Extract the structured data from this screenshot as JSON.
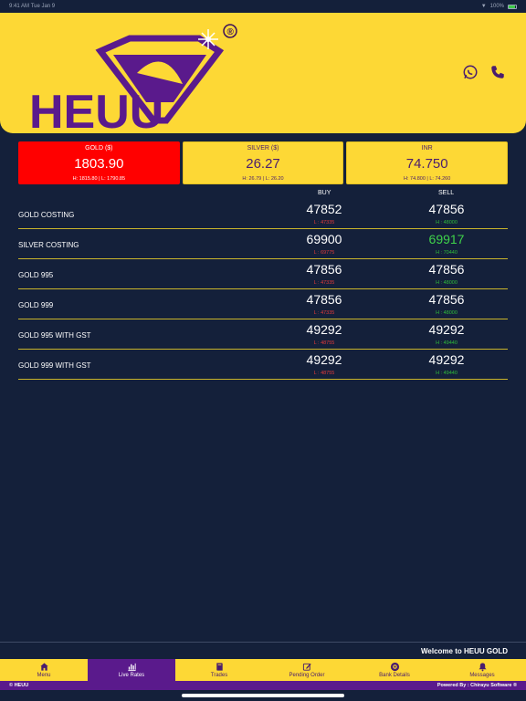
{
  "status_bar": {
    "time": "9:41 AM",
    "date": "Tue Jan 9",
    "battery": "100%"
  },
  "brand": {
    "name": "HEUU",
    "registered": "®"
  },
  "header_icons": [
    "whatsapp-icon",
    "phone-icon"
  ],
  "rate_cards": [
    {
      "title": "GOLD ($)",
      "value": "1803.90",
      "hl": "H: 1815.80 | L: 1790.85",
      "active": true
    },
    {
      "title": "SILVER ($)",
      "value": "26.27",
      "hl": "H: 26.79 | L: 26.20",
      "active": false
    },
    {
      "title": "INR",
      "value": "74.750",
      "hl": "H: 74.800 | L: 74.260",
      "active": false
    }
  ],
  "columns": {
    "buy": "BUY",
    "sell": "SELL"
  },
  "rates": [
    {
      "name": "GOLD COSTING",
      "buy": "47852",
      "buy_sub": "L : 47335",
      "sell": "47856",
      "sell_sub": "H : 48000"
    },
    {
      "name": "SILVER COSTING",
      "buy": "69900",
      "buy_sub": "L : 69775",
      "sell": "69917",
      "sell_sub": "H : 70440"
    },
    {
      "name": "GOLD 995",
      "buy": "47856",
      "buy_sub": "L : 47335",
      "sell": "47856",
      "sell_sub": "H : 48000"
    },
    {
      "name": "GOLD 999",
      "buy": "47856",
      "buy_sub": "L : 47335",
      "sell": "47856",
      "sell_sub": "H : 48000"
    },
    {
      "name": "GOLD 995 WITH GST",
      "buy": "49292",
      "buy_sub": "L : 48755",
      "sell": "49292",
      "sell_sub": "H : 49440"
    },
    {
      "name": "GOLD 999 WITH GST",
      "buy": "49292",
      "buy_sub": "L : 48755",
      "sell": "49292",
      "sell_sub": "H : 49440"
    }
  ],
  "ticker": "Welcome to HEUU GOLD",
  "nav": [
    {
      "label": "Menu",
      "icon": "home-icon",
      "active": false
    },
    {
      "label": "Live Rates",
      "icon": "chart-icon",
      "active": true
    },
    {
      "label": "Trades",
      "icon": "book-icon",
      "active": false
    },
    {
      "label": "Pending Order",
      "icon": "edit-icon",
      "active": false
    },
    {
      "label": "Bank Details",
      "icon": "bank-icon",
      "active": false
    },
    {
      "label": "Messages",
      "icon": "bell-icon",
      "active": false
    }
  ],
  "footer": {
    "left": "© HEUU",
    "right": "Powered By : Chirayu Software ®"
  },
  "colors": {
    "yellow": "#fdd835",
    "purple": "#5a1a8c",
    "navy": "#14203a",
    "red": "#ff0000",
    "green": "#3fd24a"
  }
}
